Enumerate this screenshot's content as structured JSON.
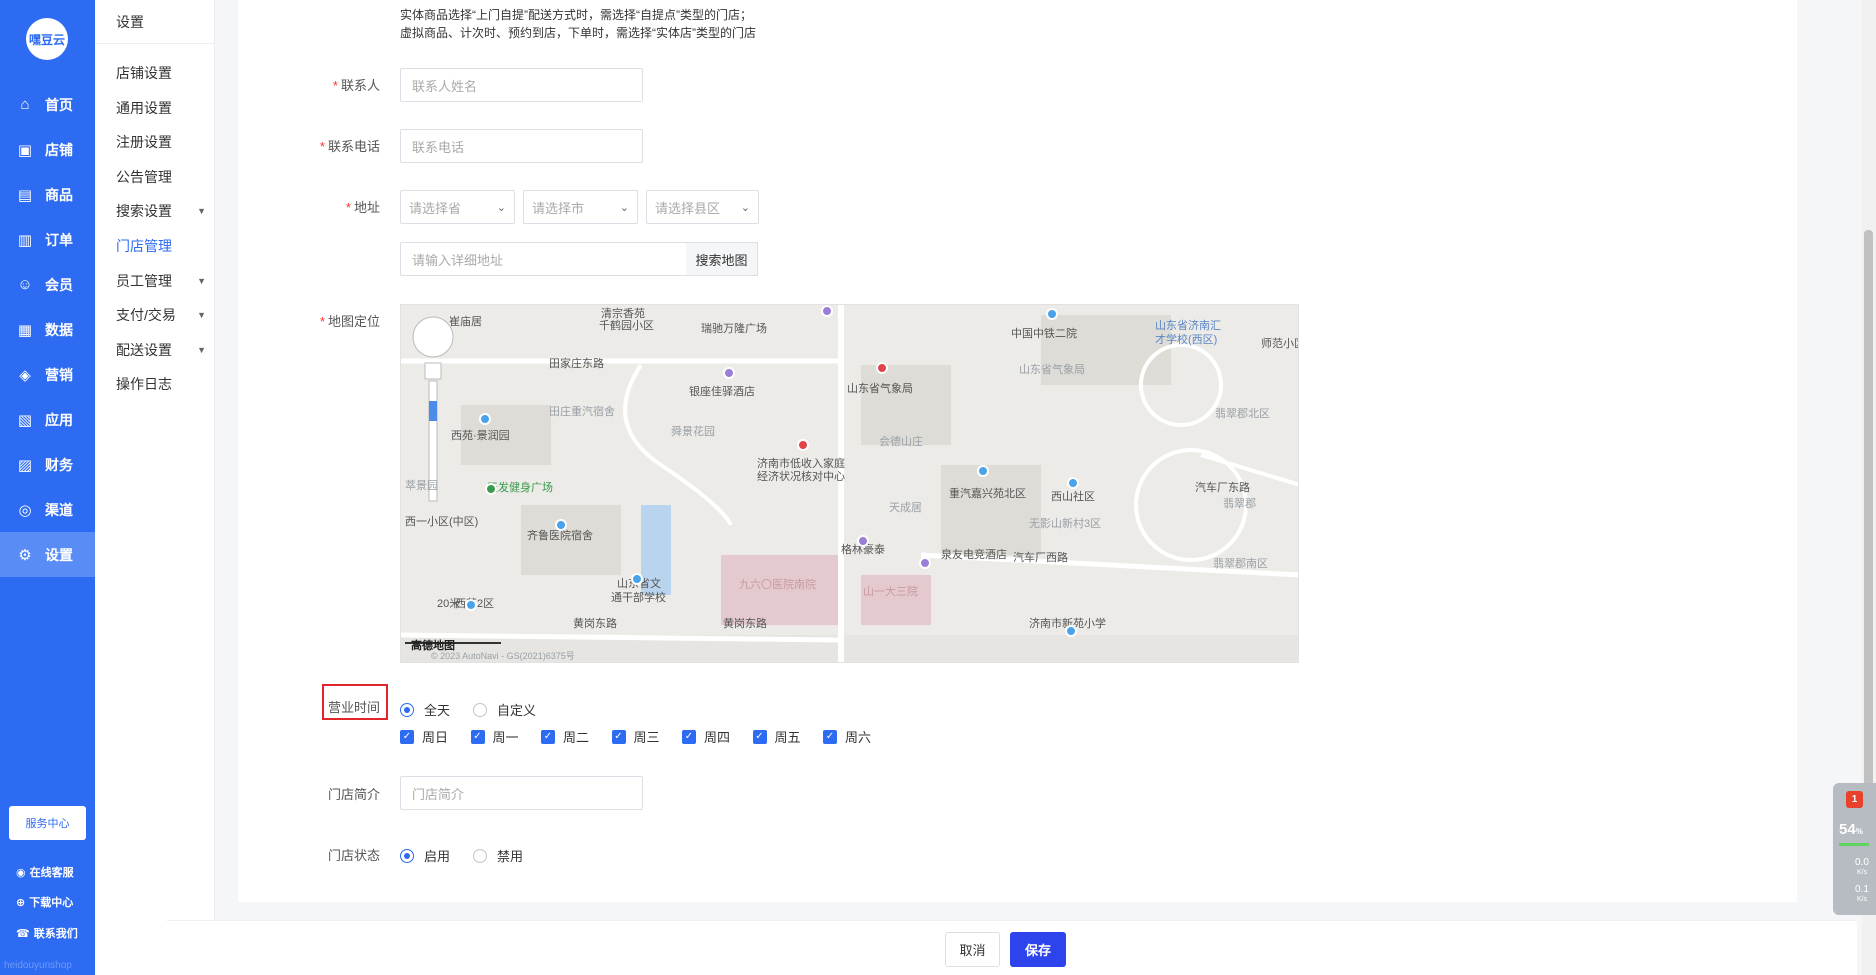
{
  "brand": {
    "logo_text": "嘿豆云"
  },
  "sidebar": {
    "items": [
      {
        "icon": "home-icon",
        "glyph": "⌂",
        "label": "首页"
      },
      {
        "icon": "shop-icon",
        "glyph": "▣",
        "label": "店铺"
      },
      {
        "icon": "goods-icon",
        "glyph": "▤",
        "label": "商品"
      },
      {
        "icon": "order-icon",
        "glyph": "▥",
        "label": "订单"
      },
      {
        "icon": "member-icon",
        "glyph": "☺",
        "label": "会员"
      },
      {
        "icon": "data-icon",
        "glyph": "▦",
        "label": "数据"
      },
      {
        "icon": "tag-icon",
        "glyph": "◈",
        "label": "营销"
      },
      {
        "icon": "app-icon",
        "glyph": "▧",
        "label": "应用"
      },
      {
        "icon": "finance-icon",
        "glyph": "▨",
        "label": "财务"
      },
      {
        "icon": "channel-icon",
        "glyph": "◎",
        "label": "渠道"
      },
      {
        "icon": "settings-icon",
        "glyph": "⚙",
        "label": "设置"
      }
    ],
    "active_index": 10,
    "service_center": "服务中心",
    "online_service": "在线客服",
    "download_center": "下载中心",
    "contact_us": "联系我们",
    "watermark": "heidouyunshop"
  },
  "submenu": {
    "title": "设置",
    "items": [
      {
        "label": "店铺设置",
        "caret": false
      },
      {
        "label": "通用设置",
        "caret": false
      },
      {
        "label": "注册设置",
        "caret": false
      },
      {
        "label": "公告管理",
        "caret": false
      },
      {
        "label": "搜索设置",
        "caret": true
      },
      {
        "label": "门店管理",
        "caret": false
      },
      {
        "label": "员工管理",
        "caret": true
      },
      {
        "label": "支付/交易",
        "caret": true
      },
      {
        "label": "配送设置",
        "caret": true
      },
      {
        "label": "操作日志",
        "caret": false
      }
    ],
    "active_index": 5
  },
  "form": {
    "hint_line1": "实体商品选择“上门自提”配送方式时，需选择“自提点”类型的门店；",
    "hint_line2": "虚拟商品、计次时、预约到店，下单时，需选择“实体店”类型的门店",
    "contact_label": "联系人",
    "contact_placeholder": "联系人姓名",
    "phone_label": "联系电话",
    "phone_placeholder": "联系电话",
    "address_label": "地址",
    "province_placeholder": "请选择省",
    "city_placeholder": "请选择市",
    "district_placeholder": "请选择县区",
    "detail_placeholder": "请输入详细地址",
    "search_map": "搜索地图",
    "map_label": "地图定位",
    "hours_label": "营业时间",
    "hours_all_day": "全天",
    "hours_custom": "自定义",
    "weekdays": [
      "周日",
      "周一",
      "周二",
      "周三",
      "周四",
      "周五",
      "周六"
    ],
    "intro_label": "门店简介",
    "intro_placeholder": "门店简介",
    "status_label": "门店状态",
    "status_enabled": "启用",
    "status_disabled": "禁用"
  },
  "map": {
    "labels": [
      {
        "t": "崔庙居",
        "c": ""
      },
      {
        "t": "清宗香苑",
        "c": ""
      },
      {
        "t": "千鹤园小区",
        "c": ""
      },
      {
        "t": "瑞驰万隆广场",
        "c": ""
      },
      {
        "t": "中国中铁二院",
        "c": ""
      },
      {
        "t": "山东省济南汇",
        "c": "blue"
      },
      {
        "t": "才学校(西区)",
        "c": "blue"
      },
      {
        "t": "师范小区",
        "c": ""
      },
      {
        "t": "田家庄东路",
        "c": ""
      },
      {
        "t": "山东省气象局",
        "c": ""
      },
      {
        "t": "山东省气象局",
        "c": "gray"
      },
      {
        "t": "银座佳驿酒店",
        "c": ""
      },
      {
        "t": "田庄重汽宿舍",
        "c": "gray"
      },
      {
        "t": "翡翠郡北区",
        "c": "gray"
      },
      {
        "t": "舜景花园",
        "c": "gray"
      },
      {
        "t": "西苑·景润园",
        "c": ""
      },
      {
        "t": "会德山庄",
        "c": "gray"
      },
      {
        "t": "济南市低收入家庭",
        "c": ""
      },
      {
        "t": "经济状况核对中心",
        "c": ""
      },
      {
        "t": "天发健身广场",
        "c": "green"
      },
      {
        "t": "萃景园",
        "c": "gray"
      },
      {
        "t": "重汽嘉兴苑北区",
        "c": ""
      },
      {
        "t": "西山社区",
        "c": ""
      },
      {
        "t": "汽车厂东路",
        "c": ""
      },
      {
        "t": "翡翠郡",
        "c": "gray"
      },
      {
        "t": "天成居",
        "c": "gray"
      },
      {
        "t": "无影山新村3区",
        "c": "gray"
      },
      {
        "t": "西一小区(中区)",
        "c": ""
      },
      {
        "t": "齐鲁医院宿舍",
        "c": ""
      },
      {
        "t": "格林豪泰",
        "c": ""
      },
      {
        "t": "泉友电竞酒店",
        "c": ""
      },
      {
        "t": "汽车厂西路",
        "c": ""
      },
      {
        "t": "翡翠郡南区",
        "c": "gray"
      },
      {
        "t": "九六〇医院南院",
        "c": "pink"
      },
      {
        "t": "山东省文",
        "c": ""
      },
      {
        "t": "通干部学校",
        "c": ""
      },
      {
        "t": "山一大三院",
        "c": "pink"
      },
      {
        "t": "20米",
        "c": ""
      },
      {
        "t": "西苑2区",
        "c": ""
      },
      {
        "t": "黄岗东路",
        "c": ""
      },
      {
        "t": "黄岗东路",
        "c": ""
      },
      {
        "t": "济南市新苑小学",
        "c": ""
      },
      {
        "t": "高德地图",
        "c": ""
      },
      {
        "t": "© 2023 AutoNavi - GS(2021)6375号",
        "c": "gray"
      }
    ]
  },
  "footer": {
    "cancel": "取消",
    "save": "保存"
  },
  "widget": {
    "badge": "1",
    "percent": "54",
    "unit": "%",
    "up": "0.0",
    "up_unit": "K/s",
    "down": "0.1",
    "down_unit": "K/s"
  },
  "colors": {
    "primary": "#2d6bf2",
    "save": "#2d43ec",
    "highlight": "#e0262a",
    "required": "#ff3333"
  }
}
